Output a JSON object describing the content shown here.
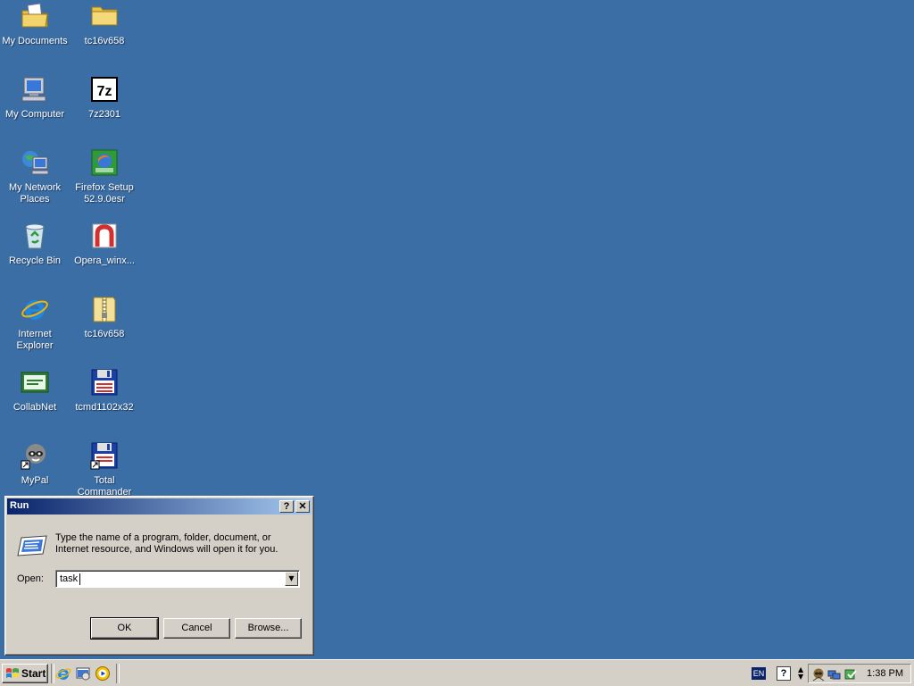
{
  "desktop": {
    "icons": [
      {
        "label": "My Documents",
        "icon": "my-documents-icon"
      },
      {
        "label": "tc16v658",
        "icon": "folder-icon"
      },
      {
        "label": "My Computer",
        "icon": "my-computer-icon"
      },
      {
        "label": "7z2301",
        "icon": "7zip-icon"
      },
      {
        "label": "My Network\nPlaces",
        "icon": "network-places-icon"
      },
      {
        "label": "Firefox Setup\n52.9.0esr",
        "icon": "firefox-setup-icon"
      },
      {
        "label": "Recycle Bin",
        "icon": "recycle-bin-icon"
      },
      {
        "label": "Opera_winx...",
        "icon": "opera-installer-icon"
      },
      {
        "label": "Internet\nExplorer",
        "icon": "internet-explorer-icon"
      },
      {
        "label": "tc16v658",
        "icon": "zip-folder-icon"
      },
      {
        "label": "CollabNet",
        "icon": "collabnet-icon"
      },
      {
        "label": "tcmd1102x32",
        "icon": "floppy-installer-icon"
      },
      {
        "label": "MyPal",
        "icon": "mypal-icon"
      },
      {
        "label": "Total\nCommander",
        "icon": "total-commander-icon"
      }
    ]
  },
  "run_dialog": {
    "title": "Run",
    "help_button": "?",
    "close_button": "✕",
    "description": "Type the name of a program, folder, document, or Internet resource, and Windows will open it for you.",
    "open_label": "Open:",
    "open_value": "task",
    "ok_label": "OK",
    "cancel_label": "Cancel",
    "browse_label": "Browse..."
  },
  "taskbar": {
    "start_label": "Start",
    "quick_launch": [
      "internet-explorer-icon",
      "show-desktop-icon",
      "media-player-icon"
    ],
    "language": "EN",
    "help_icon": "?",
    "clock": "1:38 PM"
  },
  "colors": {
    "desktop": "#3a6ea5",
    "title_start": "#0a246a",
    "title_end": "#a6caf0",
    "face": "#d4d0c8"
  }
}
